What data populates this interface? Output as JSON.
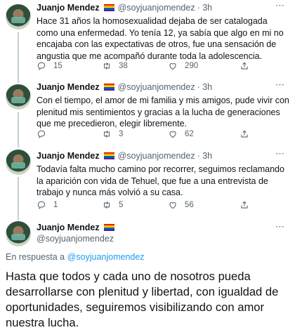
{
  "tweets": [
    {
      "name": "Juanjo Mendez",
      "handle": "@soyjuanjomendez",
      "time": "· 3h",
      "text": "Hace 31 años la homosexualidad dejaba de ser catalogada como una enfermedad. Yo tenía 12, ya sabía que algo en mi no encajaba con las expectativas de otros, fue una sensación de angustia que me acompañó durante toda la adolescencia.",
      "replies": "15",
      "retweets": "38",
      "likes": "290"
    },
    {
      "name": "Juanjo Mendez",
      "handle": "@soyjuanjomendez",
      "time": "· 3h",
      "text": "Con el tiempo, el amor de mi familia y mis amigos, pude vivir con plenitud mis sentimientos y gracias a la lucha de generaciones que me precedieron, elegir libremente.",
      "replies": "",
      "retweets": "3",
      "likes": "62"
    },
    {
      "name": "Juanjo Mendez",
      "handle": "@soyjuanjomendez",
      "time": "· 3h",
      "text": "Todavía falta mucho camino por recorrer, seguimos reclamando la aparición con vida de Tehuel, que fue a una entrevista de trabajo y nunca más volvió a su casa.",
      "replies": "1",
      "retweets": "5",
      "likes": "56"
    }
  ],
  "main_tweet": {
    "name": "Juanjo Mendez",
    "handle": "@soyjuanjomendez",
    "reply_prefix": "En respuesta a",
    "reply_handle": "@soyjuanjomendez",
    "text": "Hasta que todos y cada uno de nosotros pueda desarrollarse con plenitud y libertad, con igualdad de oportunidades, seguiremos visibilizando con amor nuestra lucha."
  },
  "icons": {
    "reply": "reply-icon",
    "retweet": "retweet-icon",
    "like": "heart-icon",
    "share": "share-icon",
    "more": "more-icon",
    "flag": "rainbow-flag-icon"
  },
  "colors": {
    "link": "#1d9bf0",
    "secondary_text": "#536471",
    "thread_line": "#c4cfd6"
  }
}
